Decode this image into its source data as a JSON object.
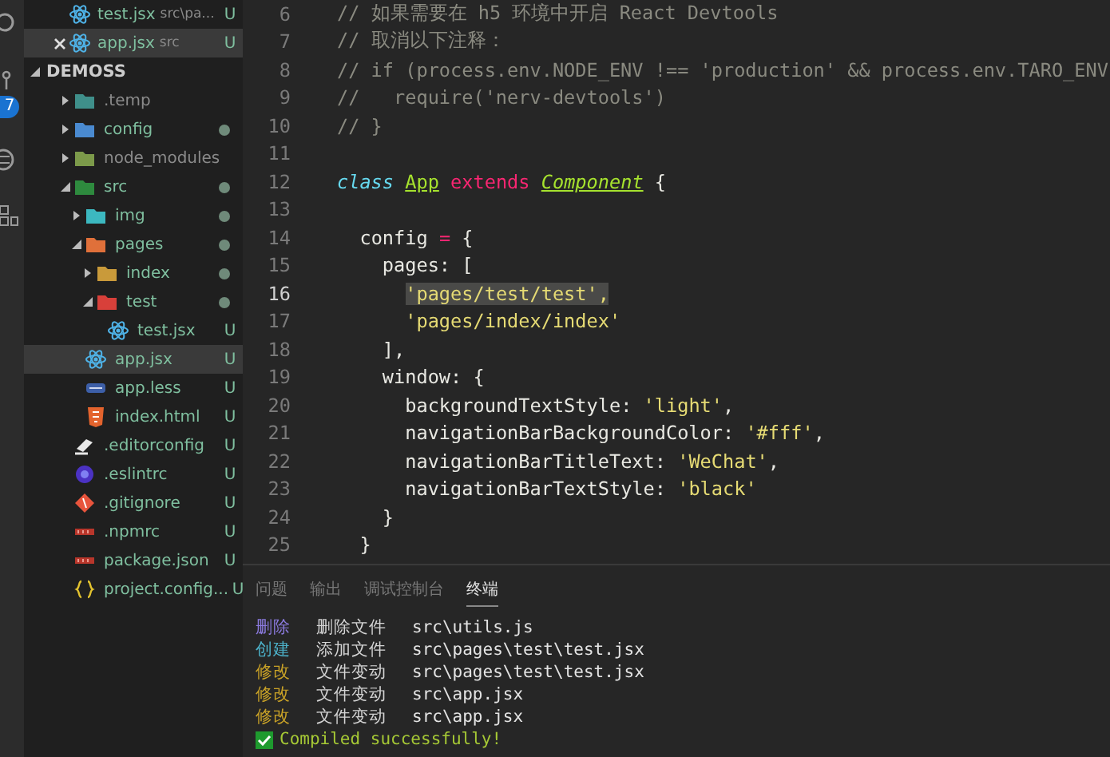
{
  "activity_bar": {
    "badge": "7"
  },
  "open_editors": [
    {
      "name": "test.jsx",
      "path": "src\\pa...",
      "badge": "U",
      "selected": false,
      "closable": false
    },
    {
      "name": "app.jsx",
      "path": "src",
      "badge": "U",
      "selected": true,
      "closable": true
    }
  ],
  "explorer": {
    "title": "DEMOSS",
    "expanded": true,
    "items": [
      {
        "kind": "folder",
        "name": ".temp",
        "expanded": false,
        "dot": false,
        "selected": false
      },
      {
        "kind": "folder",
        "name": "config",
        "expanded": false,
        "dot": true,
        "selected": false
      },
      {
        "kind": "folder",
        "name": "node_modules",
        "expanded": false,
        "dot": false,
        "selected": false
      },
      {
        "kind": "folder",
        "name": "src",
        "expanded": true,
        "dot": true,
        "selected": false,
        "children": [
          {
            "kind": "folder",
            "name": "img",
            "expanded": false,
            "dot": true,
            "selected": false
          },
          {
            "kind": "folder",
            "name": "pages",
            "expanded": true,
            "dot": true,
            "selected": false,
            "children": [
              {
                "kind": "folder",
                "name": "index",
                "expanded": false,
                "dot": true,
                "selected": false
              },
              {
                "kind": "folder",
                "name": "test",
                "expanded": true,
                "dot": true,
                "selected": false,
                "children": [
                  {
                    "kind": "jsx",
                    "name": "test.jsx",
                    "badge": "U",
                    "selected": false
                  }
                ]
              }
            ]
          },
          {
            "kind": "jsx",
            "name": "app.jsx",
            "badge": "U",
            "selected": true
          },
          {
            "kind": "less",
            "name": "app.less",
            "badge": "U",
            "selected": false
          },
          {
            "kind": "html",
            "name": "index.html",
            "badge": "U",
            "selected": false
          }
        ]
      },
      {
        "kind": "editorconfig",
        "name": ".editorconfig",
        "badge": "U",
        "selected": false
      },
      {
        "kind": "eslint",
        "name": ".eslintrc",
        "badge": "U",
        "selected": false
      },
      {
        "kind": "git",
        "name": ".gitignore",
        "badge": "U",
        "selected": false
      },
      {
        "kind": "npm",
        "name": ".npmrc",
        "badge": "U",
        "selected": false
      },
      {
        "kind": "npm",
        "name": "package.json",
        "badge": "U",
        "selected": false
      },
      {
        "kind": "json",
        "name": "project.config...",
        "badge": "U",
        "selected": false
      }
    ]
  },
  "editor": {
    "lines": [
      {
        "number": "6",
        "current": false,
        "tokens": [
          {
            "kind": "comment",
            "text": "// 如果需要在 h5 环境中开启 React Devtools"
          }
        ]
      },
      {
        "number": "7",
        "current": false,
        "tokens": [
          {
            "kind": "comment",
            "text": "// 取消以下注释："
          }
        ]
      },
      {
        "number": "8",
        "current": false,
        "tokens": [
          {
            "kind": "comment",
            "text": "// if (process.env.NODE_ENV !== 'production' && process.env.TARO_ENV"
          }
        ]
      },
      {
        "number": "9",
        "current": false,
        "tokens": [
          {
            "kind": "comment",
            "text": "//   require('nerv-devtools')"
          }
        ]
      },
      {
        "number": "10",
        "current": false,
        "tokens": [
          {
            "kind": "comment",
            "text": "// }"
          }
        ]
      },
      {
        "number": "11",
        "current": false
      },
      {
        "number": "12",
        "current": false,
        "tokens": [
          {
            "kind": "storage",
            "text": "class "
          },
          {
            "kind": "type",
            "text": "App"
          },
          {
            "kind": "keyword",
            "text": " extends "
          },
          {
            "kind": "type-italic",
            "text": "Component"
          },
          {
            "kind": "plain",
            "text": " {"
          }
        ]
      },
      {
        "number": "13",
        "current": false
      },
      {
        "number": "14",
        "current": false,
        "tokens": [
          {
            "kind": "plain",
            "text": "  config "
          },
          {
            "kind": "keyword",
            "text": "="
          },
          {
            "kind": "plain",
            "text": " {"
          }
        ]
      },
      {
        "number": "15",
        "current": false,
        "tokens": [
          {
            "kind": "plain",
            "text": "    pages: ["
          }
        ]
      },
      {
        "number": "16",
        "current": true,
        "tokens": [
          {
            "kind": "string-selected",
            "text": "      'pages/test/test',"
          }
        ]
      },
      {
        "number": "17",
        "current": false,
        "tokens": [
          {
            "kind": "string",
            "text": "      'pages/index/index'"
          }
        ]
      },
      {
        "number": "18",
        "current": false,
        "tokens": [
          {
            "kind": "plain",
            "text": "    ],"
          }
        ]
      },
      {
        "number": "19",
        "current": false,
        "tokens": [
          {
            "kind": "plain",
            "text": "    window: {"
          }
        ]
      },
      {
        "number": "20",
        "current": false,
        "tokens": [
          {
            "kind": "plain",
            "text": "      backgroundTextStyle: "
          },
          {
            "kind": "string",
            "text": "'light'"
          },
          {
            "kind": "plain",
            "text": ","
          }
        ]
      },
      {
        "number": "21",
        "current": false,
        "tokens": [
          {
            "kind": "plain",
            "text": "      navigationBarBackgroundColor: "
          },
          {
            "kind": "string",
            "text": "'#fff'"
          },
          {
            "kind": "plain",
            "text": ","
          }
        ]
      },
      {
        "number": "22",
        "current": false,
        "tokens": [
          {
            "kind": "plain",
            "text": "      navigationBarTitleText: "
          },
          {
            "kind": "string",
            "text": "'WeChat'"
          },
          {
            "kind": "plain",
            "text": ","
          }
        ]
      },
      {
        "number": "23",
        "current": false,
        "tokens": [
          {
            "kind": "plain",
            "text": "      navigationBarTextStyle: "
          },
          {
            "kind": "string",
            "text": "'black'"
          }
        ]
      },
      {
        "number": "24",
        "current": false,
        "tokens": [
          {
            "kind": "plain",
            "text": "    }"
          }
        ]
      },
      {
        "number": "25",
        "current": false,
        "tokens": [
          {
            "kind": "plain",
            "text": "  }"
          }
        ]
      }
    ]
  },
  "panel": {
    "tabs": [
      {
        "label": "问题",
        "selected": false
      },
      {
        "label": "输出",
        "selected": false
      },
      {
        "label": "调试控制台",
        "selected": false
      },
      {
        "label": "终端",
        "selected": true
      }
    ],
    "terminal": [
      {
        "kind": "delete",
        "tag": "删除",
        "action": "删除文件",
        "path": "src\\utils.js"
      },
      {
        "kind": "create",
        "tag": "创建",
        "action": "添加文件",
        "path": "src\\pages\\test\\test.jsx"
      },
      {
        "kind": "modify",
        "tag": "修改",
        "action": "文件变动",
        "path": "src\\pages\\test\\test.jsx"
      },
      {
        "kind": "modify",
        "tag": "修改",
        "action": "文件变动",
        "path": "src\\app.jsx"
      },
      {
        "kind": "modify",
        "tag": "修改",
        "action": "文件变动",
        "path": "src\\app.jsx"
      },
      {
        "kind": "success",
        "message": "Compiled successfully!"
      }
    ]
  }
}
